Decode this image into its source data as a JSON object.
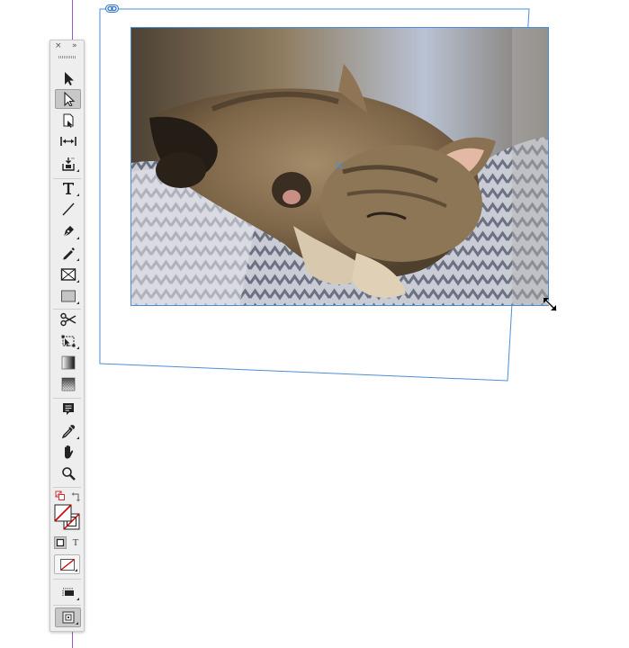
{
  "colors": {
    "frame_outline": "#4a8fd6",
    "guide": "#9b59d0",
    "toolbox_bg": "#eeeeee",
    "fill_none_slash": "#cc0000"
  },
  "toolbox": {
    "header": {
      "close": "×",
      "collapse": "»"
    },
    "tools": [
      {
        "name": "selection-tool",
        "icon": "arrow-black-icon"
      },
      {
        "name": "direct-selection-tool",
        "icon": "arrow-white-icon",
        "active": true
      },
      {
        "name": "page-tool",
        "icon": "page-icon"
      },
      {
        "name": "gap-tool",
        "icon": "gap-icon"
      },
      {
        "name": "content-collector-tool",
        "icon": "collector-icon"
      },
      {
        "name": "type-tool",
        "icon": "type-icon"
      },
      {
        "name": "line-tool",
        "icon": "line-icon"
      },
      {
        "name": "pen-tool",
        "icon": "pen-icon"
      },
      {
        "name": "pencil-tool",
        "icon": "pencil-icon"
      },
      {
        "name": "rectangle-frame-tool",
        "icon": "rectangle-frame-icon"
      },
      {
        "name": "rectangle-tool",
        "icon": "rectangle-icon"
      },
      {
        "name": "scissors-tool",
        "icon": "scissors-icon"
      },
      {
        "name": "free-transform-tool",
        "icon": "free-transform-icon"
      },
      {
        "name": "gradient-swatch-tool",
        "icon": "gradient-icon"
      },
      {
        "name": "gradient-feather-tool",
        "icon": "gradient-feather-icon"
      },
      {
        "name": "note-tool",
        "icon": "note-icon"
      },
      {
        "name": "eyedropper-tool",
        "icon": "eyedropper-icon"
      },
      {
        "name": "hand-tool",
        "icon": "hand-icon"
      },
      {
        "name": "zoom-tool",
        "icon": "zoom-icon"
      }
    ],
    "formatting_text_label": "T"
  }
}
